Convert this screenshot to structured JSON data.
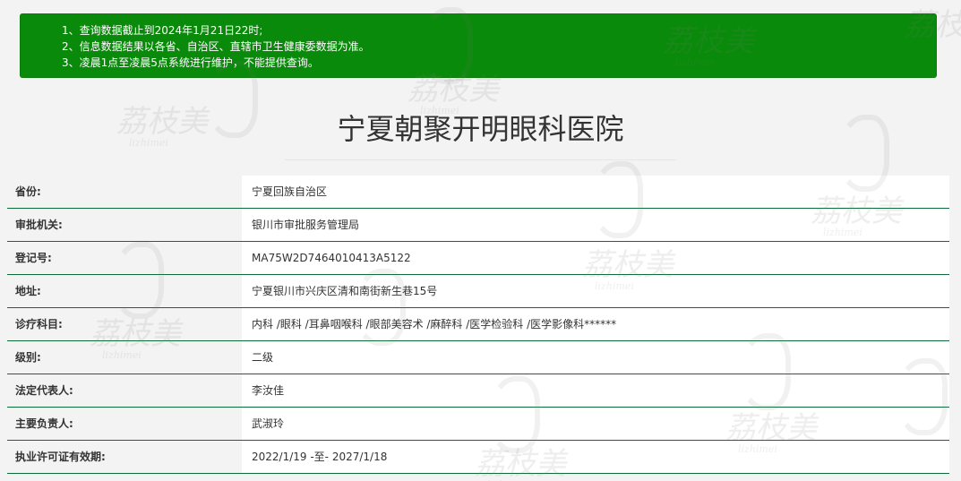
{
  "notice": {
    "lines": [
      "1、查询数据截止到2024年1月21日22时;",
      "2、信息数据结果以各省、自治区、直辖市卫生健康委数据为准。",
      "3、凌晨1点至凌晨5点系统进行维护，不能提供查询。"
    ],
    "background_color": "#0a8a0a"
  },
  "title": "宁夏朝聚开明眼科医院",
  "rows": [
    {
      "label": "省份:",
      "value": "宁夏回族自治区"
    },
    {
      "label": "审批机关:",
      "value": "银川市审批服务管理局"
    },
    {
      "label": "登记号:",
      "value": "MA75W2D7464010413A5122"
    },
    {
      "label": "地址:",
      "value": "宁夏银川市兴庆区清和南街新生巷15号"
    },
    {
      "label": "诊疗科目:",
      "value": "内科 /眼科 /耳鼻咽喉科 /眼部美容术 /麻醉科 /医学检验科 /医学影像科******"
    },
    {
      "label": "级别:",
      "value": "二级"
    },
    {
      "label": "法定代表人:",
      "value": "李汝佳"
    },
    {
      "label": "主要负责人:",
      "value": "武淑玲"
    },
    {
      "label": "执业许可证有效期:",
      "value": "2022/1/19 -至- 2027/1/18"
    }
  ],
  "watermark": {
    "text": "荔枝美",
    "subtext": "lizhimei"
  },
  "colors": {
    "row_divider": "#0d6b3a",
    "page_background": "#f3f3f3"
  }
}
